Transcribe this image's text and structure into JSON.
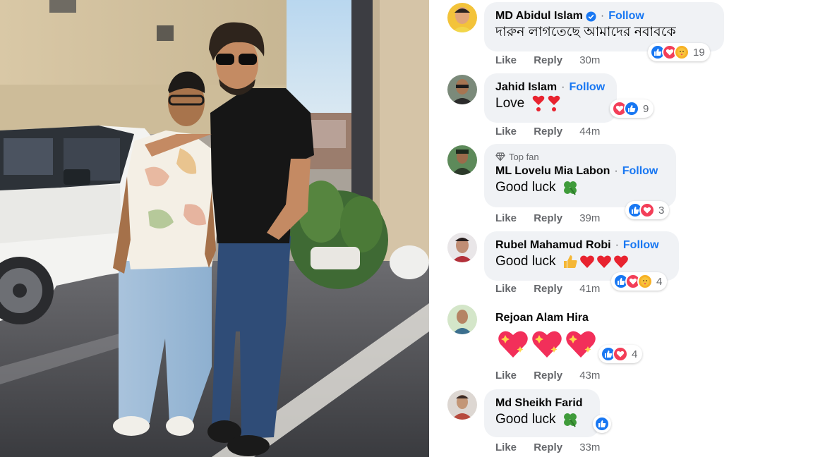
{
  "colors": {
    "accent": "#1877f2",
    "bubble": "#f0f2f5",
    "meta": "#65676b",
    "love": "#f33e58"
  },
  "actions": {
    "like": "Like",
    "reply": "Reply"
  },
  "comments": [
    {
      "author": "MD Abidul Islam",
      "verified": true,
      "follow": "Follow",
      "text": "দারুন লাগতেছে আমাদের নবাবকে",
      "time": "30m",
      "reaction_icons": [
        "like-icon",
        "love-icon",
        "care-icon"
      ],
      "count": "19"
    },
    {
      "author": "Jahid Islam",
      "follow": "Follow",
      "text": "Love",
      "emoji": [
        "heart-exclamation-icon",
        "heart-exclamation-icon"
      ],
      "time": "44m",
      "reaction_icons": [
        "love-icon",
        "like-icon"
      ],
      "count": "9"
    },
    {
      "badge": "Top fan",
      "author": "ML Lovelu Mia Labon",
      "follow": "Follow",
      "text": "Good luck",
      "emoji": [
        "four-leaf-clover-icon"
      ],
      "time": "39m",
      "reaction_icons": [
        "like-icon",
        "love-icon"
      ],
      "count": "3"
    },
    {
      "author": "Rubel Mahamud Robi",
      "follow": "Follow",
      "text": "Good luck",
      "emoji": [
        "thumbs-up-icon",
        "red-heart-icon",
        "red-heart-icon",
        "red-heart-icon"
      ],
      "time": "41m",
      "reaction_icons": [
        "like-icon",
        "love-icon",
        "care-icon"
      ],
      "count": "4"
    },
    {
      "author": "Rejoan Alam Hira",
      "text": "",
      "emoji": [
        "sparkling-heart-icon",
        "sparkling-heart-icon",
        "sparkling-heart-icon"
      ],
      "time": "43m",
      "reaction_icons": [
        "like-icon",
        "love-icon"
      ],
      "count": "4"
    },
    {
      "author": "Md Sheikh Farid",
      "text": "Good luck",
      "emoji": [
        "four-leaf-clover-icon"
      ],
      "time": "33m",
      "reaction_icons": [
        "like-icon"
      ],
      "count": ""
    }
  ]
}
